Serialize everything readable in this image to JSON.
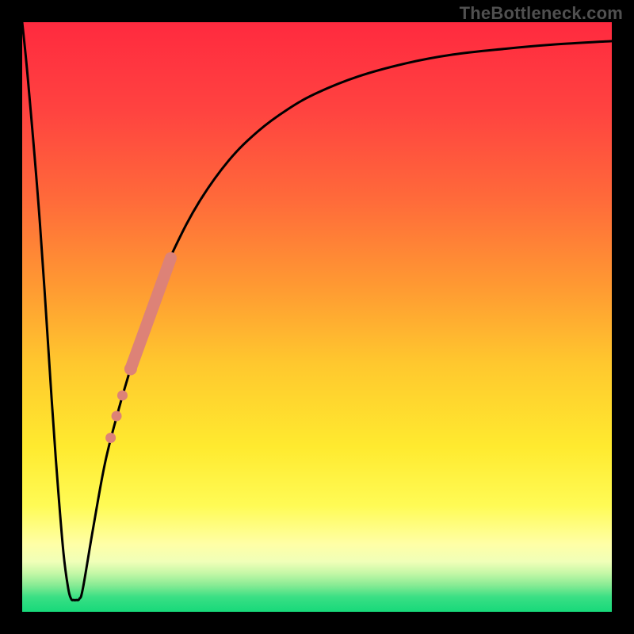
{
  "watermark": "TheBottleneck.com",
  "chart_data": {
    "type": "line",
    "title": "",
    "xlabel": "",
    "ylabel": "",
    "xlim": [
      0,
      100
    ],
    "ylim": [
      0,
      100
    ],
    "background_gradient": {
      "stops": [
        {
          "offset": 0.0,
          "color": "#ff2a3f"
        },
        {
          "offset": 0.15,
          "color": "#ff4340"
        },
        {
          "offset": 0.3,
          "color": "#ff6a3a"
        },
        {
          "offset": 0.45,
          "color": "#ff9a32"
        },
        {
          "offset": 0.58,
          "color": "#ffc82e"
        },
        {
          "offset": 0.72,
          "color": "#ffea2f"
        },
        {
          "offset": 0.82,
          "color": "#fffb55"
        },
        {
          "offset": 0.885,
          "color": "#ffffa6"
        },
        {
          "offset": 0.915,
          "color": "#f0ffb8"
        },
        {
          "offset": 0.935,
          "color": "#c4f7a6"
        },
        {
          "offset": 0.955,
          "color": "#87eb94"
        },
        {
          "offset": 0.975,
          "color": "#3adf84"
        },
        {
          "offset": 1.0,
          "color": "#17d97a"
        }
      ]
    },
    "series": [
      {
        "name": "curve",
        "stroke": "#000000",
        "points": [
          {
            "x": 0.0,
            "y": 100.0
          },
          {
            "x": 1.0,
            "y": 90.0
          },
          {
            "x": 3.0,
            "y": 66.0
          },
          {
            "x": 5.0,
            "y": 36.0
          },
          {
            "x": 6.0,
            "y": 22.0
          },
          {
            "x": 7.0,
            "y": 10.0
          },
          {
            "x": 7.8,
            "y": 4.0
          },
          {
            "x": 8.3,
            "y": 2.2
          },
          {
            "x": 8.7,
            "y": 2.0
          },
          {
            "x": 9.2,
            "y": 2.0
          },
          {
            "x": 9.7,
            "y": 2.2
          },
          {
            "x": 10.3,
            "y": 4.0
          },
          {
            "x": 12.0,
            "y": 14.0
          },
          {
            "x": 14.0,
            "y": 25.0
          },
          {
            "x": 16.0,
            "y": 33.0
          },
          {
            "x": 18.0,
            "y": 40.0
          },
          {
            "x": 20.5,
            "y": 48.0
          },
          {
            "x": 23.0,
            "y": 55.0
          },
          {
            "x": 26.0,
            "y": 62.0
          },
          {
            "x": 30.0,
            "y": 69.5
          },
          {
            "x": 35.0,
            "y": 76.5
          },
          {
            "x": 40.0,
            "y": 81.5
          },
          {
            "x": 45.0,
            "y": 85.2
          },
          {
            "x": 50.0,
            "y": 88.0
          },
          {
            "x": 57.0,
            "y": 90.8
          },
          {
            "x": 65.0,
            "y": 93.0
          },
          {
            "x": 73.0,
            "y": 94.5
          },
          {
            "x": 82.0,
            "y": 95.5
          },
          {
            "x": 90.0,
            "y": 96.2
          },
          {
            "x": 100.0,
            "y": 96.8
          }
        ]
      },
      {
        "name": "highlight-band",
        "stroke": "#dd8277",
        "thick": true,
        "points": [
          {
            "x": 18.5,
            "y": 41.5
          },
          {
            "x": 25.2,
            "y": 60.0
          }
        ]
      }
    ],
    "markers": {
      "color": "#dd8277",
      "radius_large": 8,
      "radius_small": 6.5,
      "points": [
        {
          "x": 18.4,
          "y": 41.2
        },
        {
          "x": 17.0,
          "y": 36.7
        },
        {
          "x": 16.0,
          "y": 33.2
        },
        {
          "x": 15.0,
          "y": 29.5
        }
      ]
    }
  }
}
